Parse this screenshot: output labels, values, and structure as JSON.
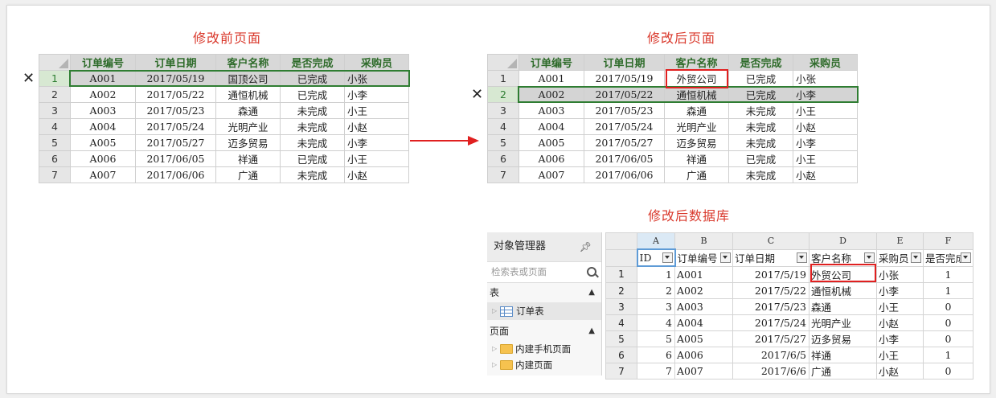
{
  "titles": {
    "before": "修改前页面",
    "after": "修改后页面",
    "database": "修改后数据库"
  },
  "columns": [
    "订单编号",
    "订单日期",
    "客户名称",
    "是否完成",
    "采购员"
  ],
  "before_rows": [
    {
      "n": "1",
      "id": "A001",
      "date": "2017/05/19",
      "customer": "国顶公司",
      "done": "已完成",
      "buyer": "小张"
    },
    {
      "n": "2",
      "id": "A002",
      "date": "2017/05/22",
      "customer": "通恒机械",
      "done": "已完成",
      "buyer": "小李"
    },
    {
      "n": "3",
      "id": "A003",
      "date": "2017/05/23",
      "customer": "森通",
      "done": "未完成",
      "buyer": "小王"
    },
    {
      "n": "4",
      "id": "A004",
      "date": "2017/05/24",
      "customer": "光明产业",
      "done": "未完成",
      "buyer": "小赵"
    },
    {
      "n": "5",
      "id": "A005",
      "date": "2017/05/27",
      "customer": "迈多贸易",
      "done": "未完成",
      "buyer": "小李"
    },
    {
      "n": "6",
      "id": "A006",
      "date": "2017/06/05",
      "customer": "祥通",
      "done": "已完成",
      "buyer": "小王"
    },
    {
      "n": "7",
      "id": "A007",
      "date": "2017/06/06",
      "customer": "广通",
      "done": "未完成",
      "buyer": "小赵"
    }
  ],
  "after_rows": [
    {
      "n": "1",
      "id": "A001",
      "date": "2017/05/19",
      "customer": "外贸公司",
      "done": "已完成",
      "buyer": "小张"
    },
    {
      "n": "2",
      "id": "A002",
      "date": "2017/05/22",
      "customer": "通恒机械",
      "done": "已完成",
      "buyer": "小李"
    },
    {
      "n": "3",
      "id": "A003",
      "date": "2017/05/23",
      "customer": "森通",
      "done": "未完成",
      "buyer": "小王"
    },
    {
      "n": "4",
      "id": "A004",
      "date": "2017/05/24",
      "customer": "光明产业",
      "done": "未完成",
      "buyer": "小赵"
    },
    {
      "n": "5",
      "id": "A005",
      "date": "2017/05/27",
      "customer": "迈多贸易",
      "done": "未完成",
      "buyer": "小李"
    },
    {
      "n": "6",
      "id": "A006",
      "date": "2017/06/05",
      "customer": "祥通",
      "done": "已完成",
      "buyer": "小王"
    },
    {
      "n": "7",
      "id": "A007",
      "date": "2017/06/06",
      "customer": "广通",
      "done": "未完成",
      "buyer": "小赵"
    }
  ],
  "delete_mark": "✕",
  "object_manager": {
    "title": "对象管理器",
    "search_placeholder": "检索表或页面",
    "section_tables": "表",
    "table_item": "订单表",
    "section_pages": "页面",
    "page_items": [
      "内建手机页面",
      "内建页面"
    ]
  },
  "db": {
    "col_letters": [
      "A",
      "B",
      "C",
      "D",
      "E",
      "F"
    ],
    "headers": [
      "ID",
      "订单编号",
      "订单日期",
      "客户名称",
      "采购员",
      "是否完成"
    ],
    "rows": [
      {
        "n": "1",
        "id": "1",
        "code": "A001",
        "date": "2017/5/19",
        "customer": "外贸公司",
        "buyer": "小张",
        "done": "1"
      },
      {
        "n": "2",
        "id": "2",
        "code": "A002",
        "date": "2017/5/22",
        "customer": "通恒机械",
        "buyer": "小李",
        "done": "1"
      },
      {
        "n": "3",
        "id": "3",
        "code": "A003",
        "date": "2017/5/23",
        "customer": "森通",
        "buyer": "小王",
        "done": "0"
      },
      {
        "n": "4",
        "id": "4",
        "code": "A004",
        "date": "2017/5/24",
        "customer": "光明产业",
        "buyer": "小赵",
        "done": "0"
      },
      {
        "n": "5",
        "id": "5",
        "code": "A005",
        "date": "2017/5/27",
        "customer": "迈多贸易",
        "buyer": "小李",
        "done": "0"
      },
      {
        "n": "6",
        "id": "6",
        "code": "A006",
        "date": "2017/6/5",
        "customer": "祥通",
        "buyer": "小王",
        "done": "1"
      },
      {
        "n": "7",
        "id": "7",
        "code": "A007",
        "date": "2017/6/6",
        "customer": "广通",
        "buyer": "小赵",
        "done": "0"
      }
    ]
  }
}
